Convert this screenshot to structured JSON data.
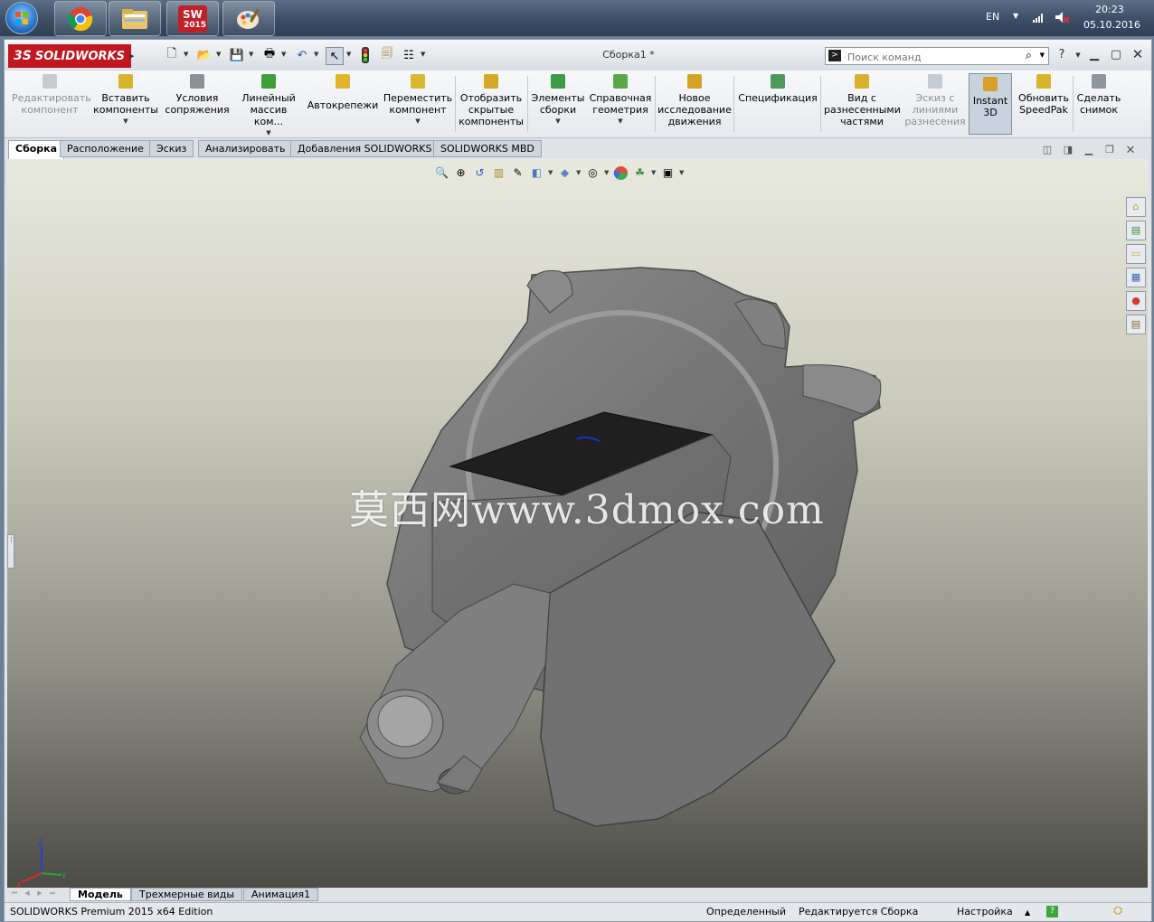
{
  "taskbar": {
    "apps": [
      {
        "name": "Google Chrome",
        "icon": "chrome-icon"
      },
      {
        "name": "Проводник",
        "icon": "folder-icon"
      },
      {
        "name": "SOLIDWORKS 2015",
        "icon": "solidworks-icon",
        "badge": "2015",
        "letters": "SW"
      },
      {
        "name": "Paint",
        "icon": "paint-icon"
      }
    ],
    "language": "EN",
    "time": "20:23",
    "date": "05.10.2016"
  },
  "titlebar": {
    "logo": "SOLIDWORKS",
    "logo_prefix": "3S",
    "document_title": "Сборка1 *",
    "search_placeholder": "Поиск команд",
    "help_glyph": "?"
  },
  "ribbon": {
    "buttons": [
      {
        "label": "Редактировать\nкомпонент",
        "disabled": true,
        "dropdown": false,
        "color": "#9aa3ad"
      },
      {
        "label": "Вставить\nкомпоненты",
        "disabled": false,
        "dropdown": true,
        "color": "#d6b42b"
      },
      {
        "label": "Условия\nсопряжения",
        "disabled": false,
        "dropdown": false,
        "color": "#6a6f76"
      },
      {
        "label": "Линейный\nмассив ком...",
        "disabled": false,
        "dropdown": true,
        "color": "#3f9e3a"
      },
      {
        "label": "Автокрепежи",
        "disabled": false,
        "dropdown": false,
        "color": "#e1b52b"
      },
      {
        "label": "Переместить\nкомпонент",
        "disabled": false,
        "dropdown": true,
        "color": "#d9b733"
      },
      {
        "label": "Отобразить\nскрытые\nкомпоненты",
        "disabled": false,
        "dropdown": false,
        "color": "#d8a72a"
      },
      {
        "label": "Элементы\nсборки",
        "disabled": false,
        "dropdown": true,
        "color": "#3c9b47"
      },
      {
        "label": "Справочная\nгеометрия",
        "disabled": false,
        "dropdown": true,
        "color": "#5aa84a"
      },
      {
        "label": "Новое\nисследование\nдвижения",
        "disabled": false,
        "dropdown": false,
        "color": "#d5a227"
      },
      {
        "label": "Спецификация",
        "disabled": false,
        "dropdown": false,
        "color": "#4e9a5d"
      },
      {
        "label": "Вид с\nразнесенными\nчастями",
        "disabled": false,
        "dropdown": false,
        "color": "#d7b12c"
      },
      {
        "label": "Эскиз с\nлиниями\nразнесения",
        "disabled": true,
        "dropdown": false,
        "color": "#9aa3ad"
      },
      {
        "label": "Instant\n3D",
        "disabled": false,
        "dropdown": false,
        "active": true,
        "color": "#d8a02b"
      },
      {
        "label": "Обновить\nSpeedPak",
        "disabled": false,
        "dropdown": false,
        "color": "#d6b42b"
      },
      {
        "label": "Сделать\nснимок",
        "disabled": false,
        "dropdown": false,
        "color": "#8e959d"
      }
    ]
  },
  "tabs": [
    "Сборка",
    "Расположение",
    "Эскиз",
    "Анализировать",
    "Добавления SOLIDWORKS",
    "SOLIDWORKS MBD"
  ],
  "active_tab": "Сборка",
  "viewport": {
    "watermark": "莫西网www.3dmox.com",
    "triad": {
      "z": "Z",
      "y": "Y",
      "x": "X"
    },
    "heads_up_tools": [
      "zoom-fit-icon",
      "zoom-area-icon",
      "previous-view-icon",
      "section-view-icon",
      "dynamic-annotation-icon",
      "view-orientation-icon",
      "display-style-icon",
      "hide-show-icon",
      "edit-appearance-icon",
      "apply-scene-icon",
      "view-settings-icon"
    ]
  },
  "task_pane": [
    "home-icon",
    "design-library-icon",
    "file-explorer-icon",
    "view-palette-icon",
    "appearances-icon",
    "custom-properties-icon"
  ],
  "bottom_tabs": [
    "Модель",
    "Трехмерные виды",
    "Анимация1"
  ],
  "active_bottom_tab": "Модель",
  "status": {
    "edition": "SOLIDWORKS Premium 2015 x64 Edition",
    "state": "Определенный",
    "editing": "Редактируется Сборка",
    "units": "Настройка"
  }
}
